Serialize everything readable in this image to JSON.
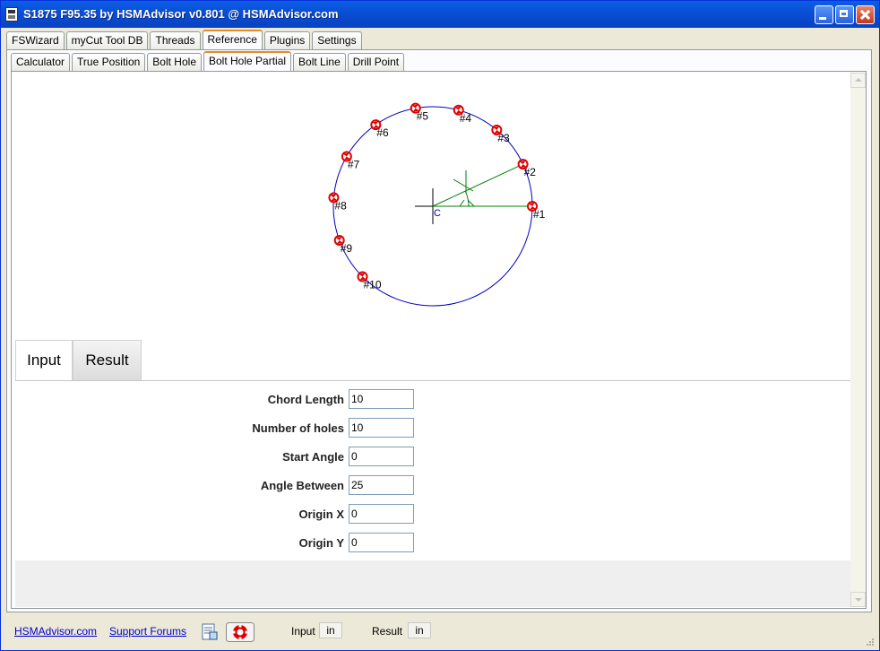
{
  "window": {
    "title": "S1875 F95.35 by HSMAdvisor v0.801 @ HSMAdvisor.com"
  },
  "main_tabs": [
    "FSWizard",
    "myCut Tool DB",
    "Threads",
    "Reference",
    "Plugins",
    "Settings"
  ],
  "main_tab_active": "Reference",
  "sub_tabs": [
    "Calculator",
    "True Position",
    "Bolt Hole",
    "Bolt Hole Partial",
    "Bolt Line",
    "Drill Point"
  ],
  "sub_tab_active": "Bolt Hole Partial",
  "diagram": {
    "center_label": "C",
    "holes": [
      "#1",
      "#2",
      "#3",
      "#4",
      "#5",
      "#6",
      "#7",
      "#8",
      "#9",
      "#10"
    ],
    "circle_color": "#0000c0",
    "construction_color": "#008000",
    "hole_color": "#e00000"
  },
  "io_tabs": {
    "input": "Input",
    "result": "Result",
    "active": "Input"
  },
  "form": {
    "fields": [
      {
        "label": "Chord Length",
        "value": "10"
      },
      {
        "label": "Number of holes",
        "value": "10"
      },
      {
        "label": "Start Angle",
        "value": "0"
      },
      {
        "label": "Angle Between",
        "value": "25"
      },
      {
        "label": "Origin X",
        "value": "0"
      },
      {
        "label": "Origin Y",
        "value": "0"
      }
    ]
  },
  "status_bar": {
    "link_site": "HSMAdvisor.com",
    "link_forums": "Support Forums",
    "input_label": "Input",
    "input_unit": "in",
    "result_label": "Result",
    "result_unit": "in",
    "icons": [
      "notes-icon",
      "lifebuoy-icon"
    ]
  }
}
